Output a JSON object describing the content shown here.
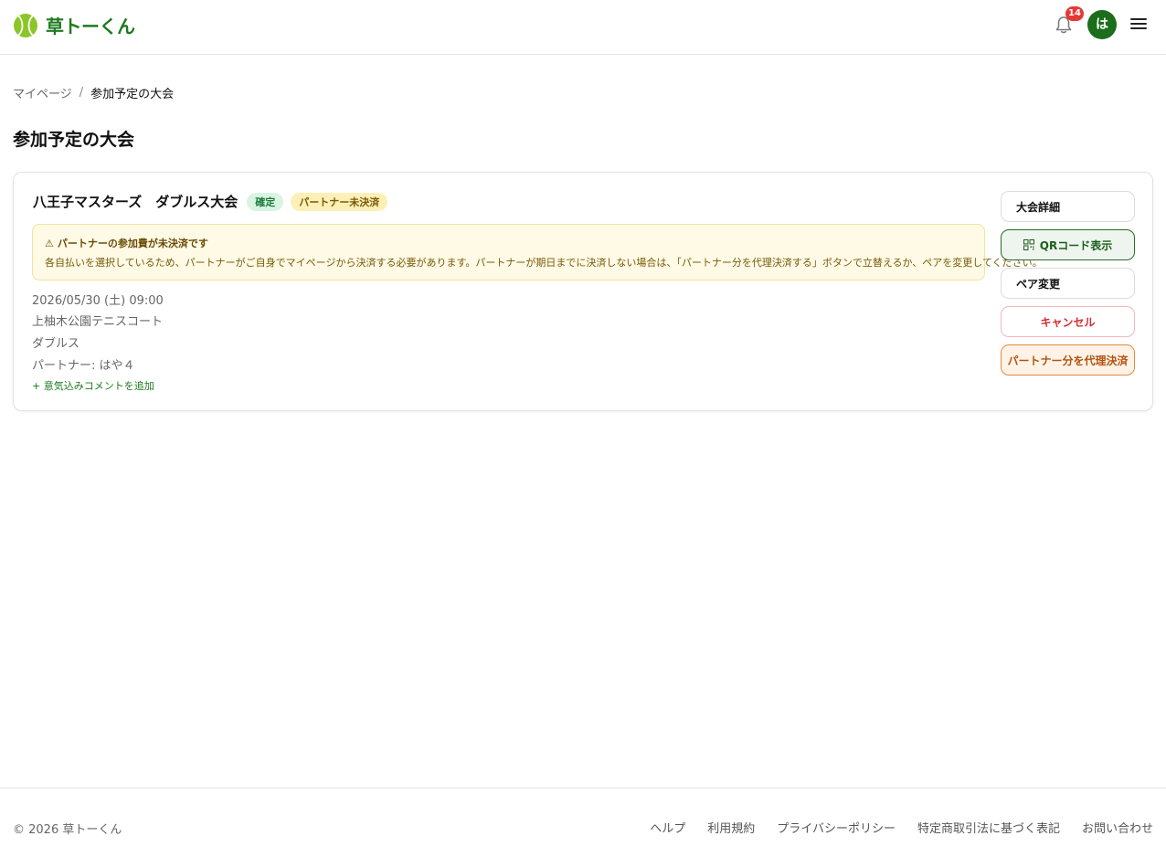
{
  "header": {
    "logo_text": "草トーくん",
    "notification_count": "14",
    "avatar_initial": "は"
  },
  "breadcrumb": {
    "root": "マイページ",
    "separator": "/",
    "current": "参加予定の大会"
  },
  "page_title": "参加予定の大会",
  "tournament": {
    "title": "八王子マスターズ　ダブルス大会",
    "badges": {
      "confirmed": "確定",
      "partner_unpaid": "パートナー未決済"
    },
    "warning": {
      "icon": "⚠",
      "title": "パートナーの参加費が未決済です",
      "body": "各自払いを選択しているため、パートナーがご自身でマイページから決済する必要があります。パートナーが期日までに決済しない場合は、「パートナー分を代理決済する」ボタンで立替えるか、ペアを変更してください。"
    },
    "datetime": "2026/05/30 (土) 09:00",
    "venue": "上柚木公園テニスコート",
    "format": "ダブルス",
    "partner": "パートナー: はや４",
    "add_comment": "+ 意気込みコメントを追加",
    "actions": {
      "detail": "大会詳細",
      "qr": "QRコード表示",
      "pair_change": "ペア変更",
      "cancel": "キャンセル",
      "proxy_pay": "パートナー分を代理決済"
    }
  },
  "footer": {
    "copyright": "© 2026 草トーくん",
    "links": [
      "ヘルプ",
      "利用規約",
      "プライバシーポリシー",
      "特定商取引法に基づく表記",
      "お問い合わせ"
    ]
  },
  "colors": {
    "brand_green": "#1f7a1f",
    "badge_red": "#e53935",
    "warning_bg": "#fefae6",
    "cancel_red": "#d32f2f",
    "proxy_orange": "#b3520e"
  }
}
